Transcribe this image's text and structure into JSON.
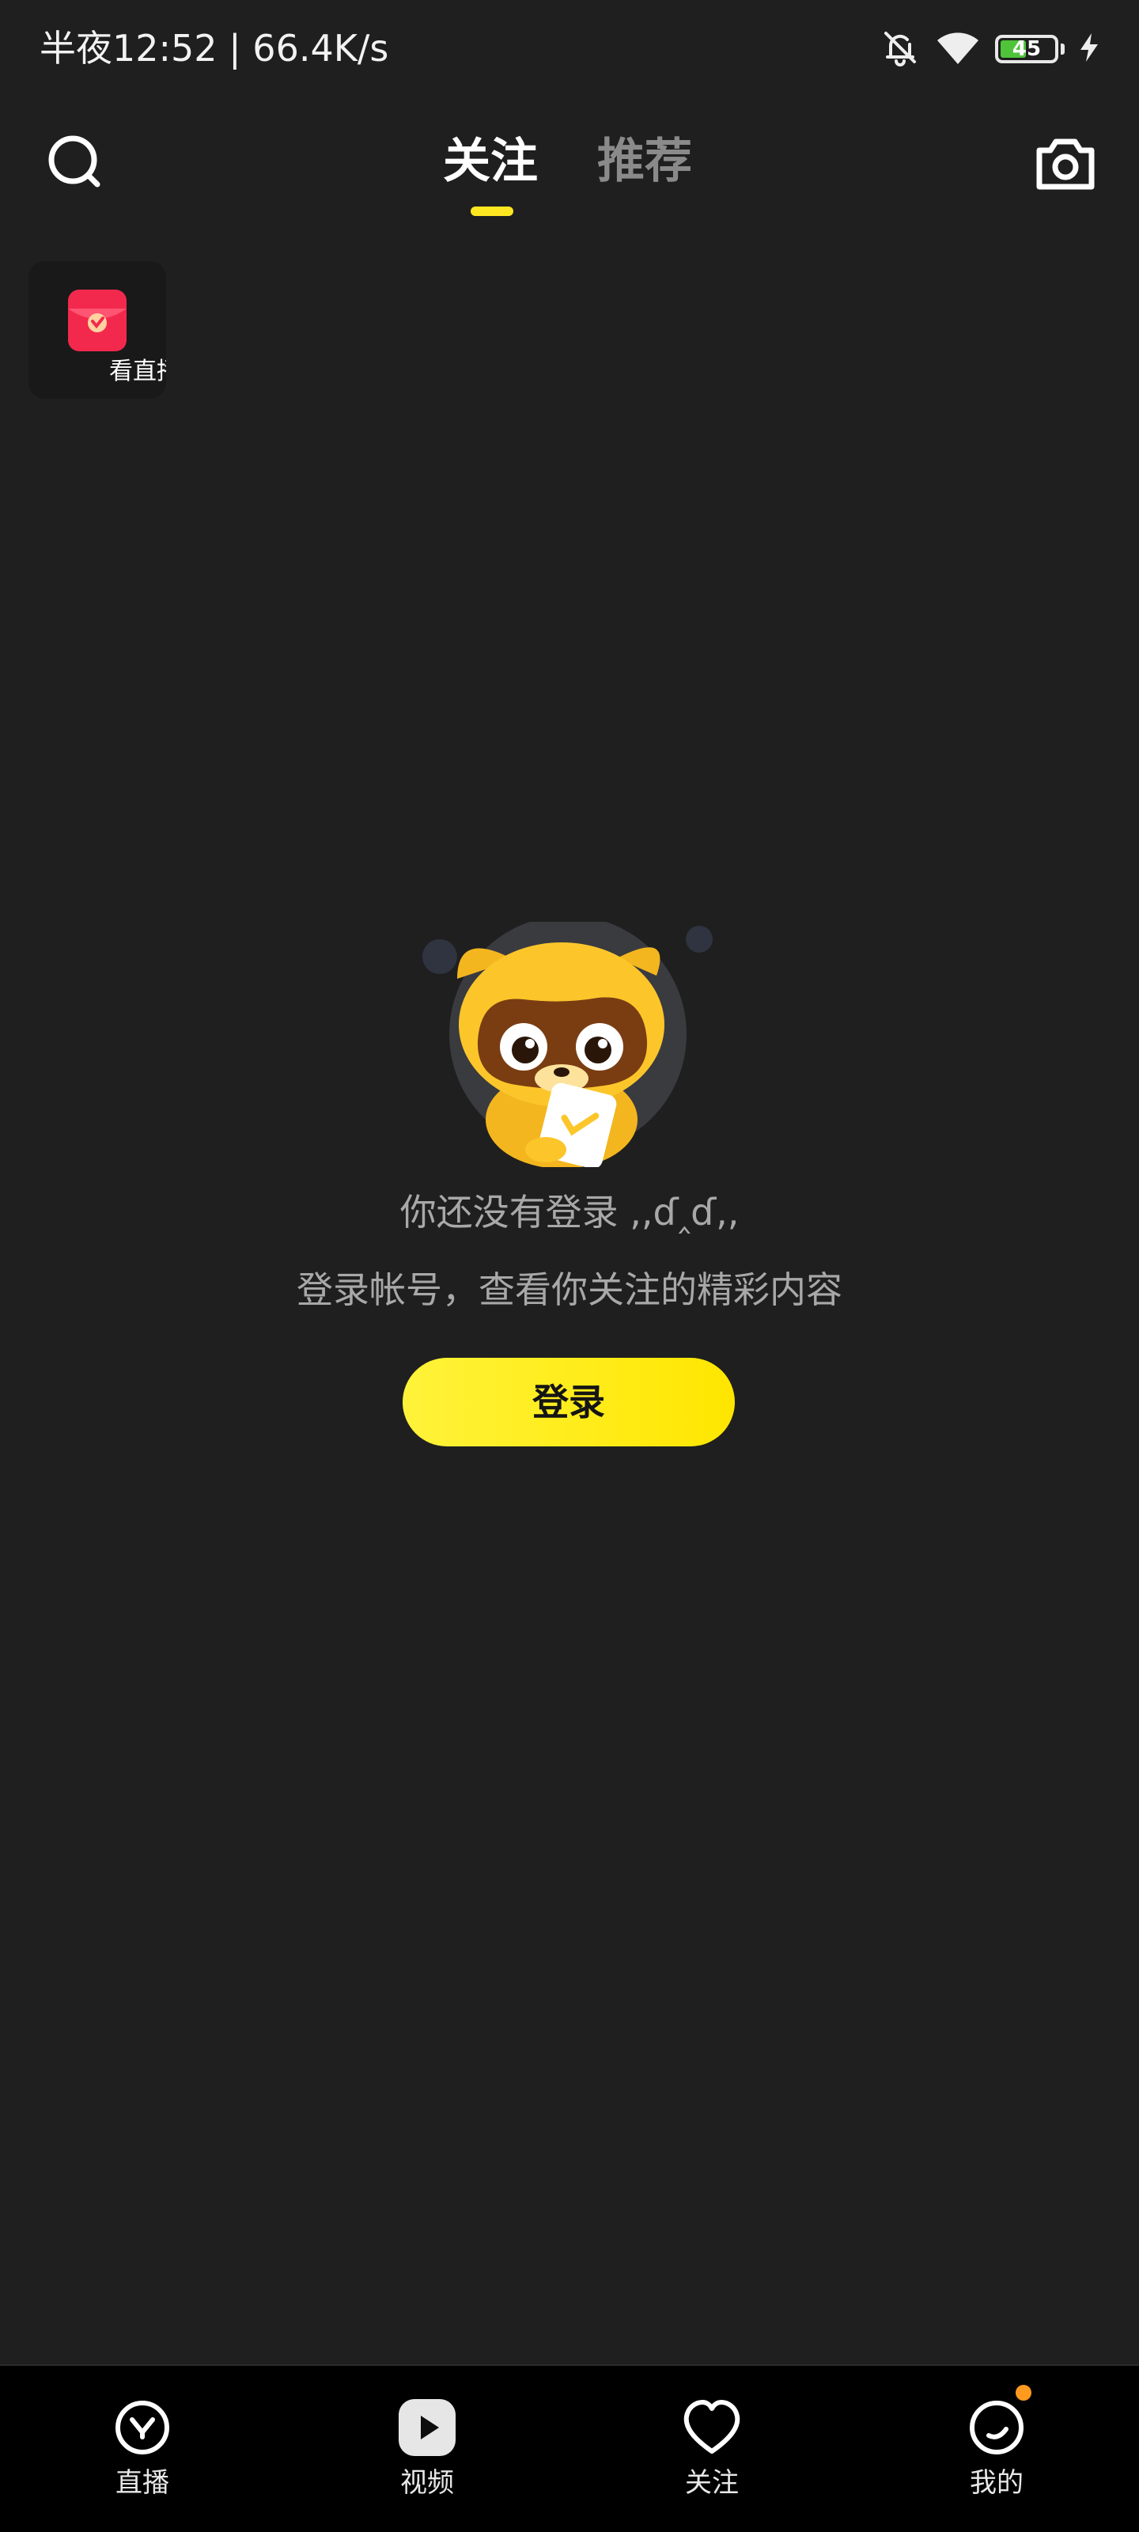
{
  "status_bar": {
    "time_and_speed": "半夜12:52 | 66.4K/s",
    "battery_level": "45",
    "battery_fraction": 0.45,
    "icons": [
      "bell-off-icon",
      "wifi-icon",
      "battery-icon",
      "charging-bolt-icon"
    ]
  },
  "top_nav": {
    "tabs": [
      {
        "label": "关注",
        "active": true
      },
      {
        "label": "推荐",
        "active": false
      }
    ],
    "left_icon": "search-icon",
    "right_icon": "camera-icon"
  },
  "floating_card": {
    "icon": "red-packet-icon",
    "label": "看直播"
  },
  "empty_state": {
    "title": "你还没有登录 ,,ʘ̥ʘ,,",
    "title_display": "你还没有登录 ,,ɗ‸ɗ,,",
    "subtitle": "登录帐号，查看你关注的精彩内容",
    "button_label": "登录",
    "illustration": "raccoon-mascot"
  },
  "bottom_nav": {
    "items": [
      {
        "label": "直播",
        "icon": "live-icon"
      },
      {
        "label": "视频",
        "icon": "video-play-icon"
      },
      {
        "label": "关注",
        "icon": "heart-icon"
      },
      {
        "label": "我的",
        "icon": "profile-icon",
        "badge": true
      }
    ]
  },
  "colors": {
    "background": "#1f1f1f",
    "accent_yellow": "#ffe600",
    "tab_inactive": "#8a8a8a",
    "text_secondary": "#a8a8a8",
    "badge_orange": "#ff9a1f",
    "battery_green": "#4fc43a"
  }
}
